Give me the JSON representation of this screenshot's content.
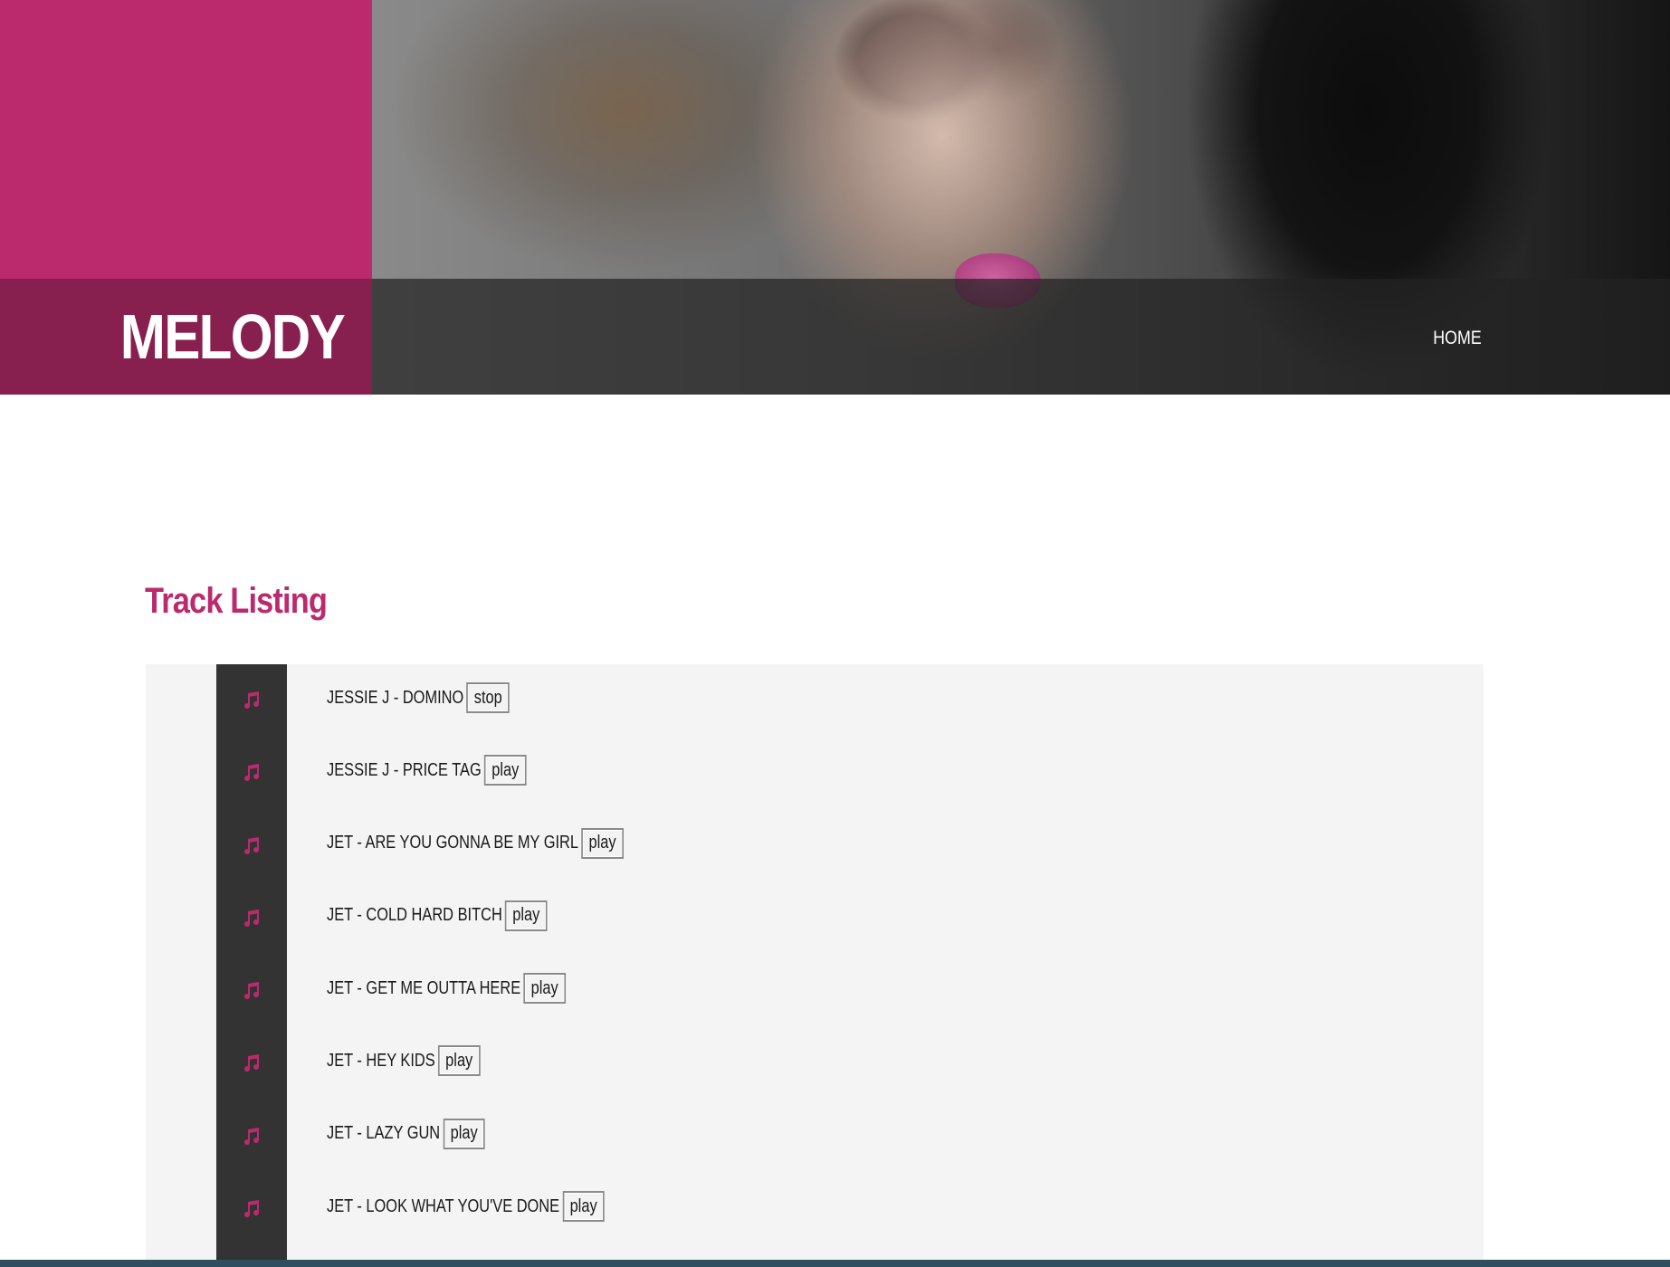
{
  "header": {
    "logo": "MELODY",
    "nav": [
      {
        "label": "HOME"
      }
    ]
  },
  "main": {
    "section_title": "Track Listing",
    "tracks": [
      {
        "title": "JESSIE J - DOMINO",
        "button": "stop"
      },
      {
        "title": "JESSIE J - PRICE TAG",
        "button": "play"
      },
      {
        "title": "JET - ARE YOU GONNA BE MY GIRL",
        "button": "play"
      },
      {
        "title": "JET - COLD HARD BITCH",
        "button": "play"
      },
      {
        "title": "JET - GET ME OUTTA HERE",
        "button": "play"
      },
      {
        "title": "JET - HEY KIDS",
        "button": "play"
      },
      {
        "title": "JET - LAZY GUN",
        "button": "play"
      },
      {
        "title": "JET - LOOK WHAT YOU'VE DONE",
        "button": "play"
      }
    ]
  },
  "colors": {
    "brand": "#bc2a6e",
    "brand_dark": "#88204f",
    "rail": "#333333",
    "panel": "#f3f4f3",
    "footer": "#2f4e5f"
  },
  "icons": {
    "track": "music-note-icon"
  }
}
